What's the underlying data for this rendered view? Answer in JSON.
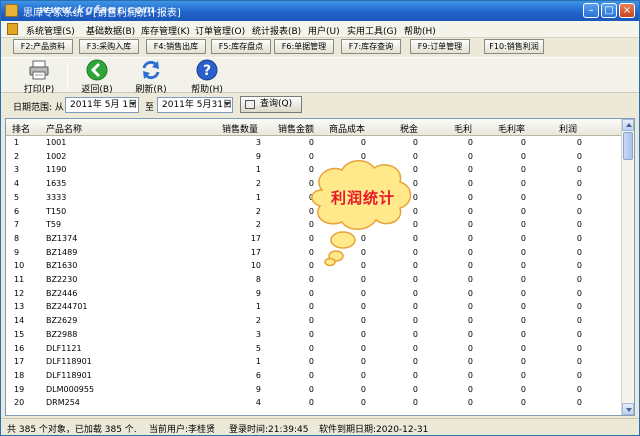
{
  "window": {
    "title": "思库专家系统 - [销售利润统计报表]",
    "watermark": "www.kgfanr.com"
  },
  "menu": {
    "items": [
      "系统管理(S)",
      "基础数据(B)",
      "库存管理(K)",
      "订单管理(O)",
      "统计报表(B)",
      "用户(U)",
      "实用工具(G)",
      "帮助(H)"
    ]
  },
  "fkeys": [
    "F2:产品资料",
    "F3:采购入库",
    "F4:销售出库",
    "F5:库存盘点",
    "F6:单据管理",
    "F7:库存查询",
    "F9:订单管理",
    "F10:销售利润"
  ],
  "toolbar": {
    "print": "打印(P)",
    "back": "返回(B)",
    "refresh": "刷新(R)",
    "help": "帮助(H)"
  },
  "filter": {
    "range_label": "日期范围: 从",
    "from_date": "2011年 5月 1日",
    "to_label": "至",
    "to_date": "2011年 5月31日",
    "query_label": "查询(Q)"
  },
  "table": {
    "columns": [
      "排名",
      "产品名称",
      "销售数量",
      "销售金额",
      "商品成本",
      "税金",
      "毛利",
      "毛利率",
      "利润"
    ],
    "rows": [
      [
        "1",
        "1001",
        "3",
        "0",
        "0",
        "0",
        "0",
        "0",
        "0"
      ],
      [
        "2",
        "1002",
        "9",
        "0",
        "0",
        "0",
        "0",
        "0",
        "0"
      ],
      [
        "3",
        "1190",
        "1",
        "0",
        "0",
        "0",
        "0",
        "0",
        "0"
      ],
      [
        "4",
        "1635",
        "2",
        "0",
        "0",
        "0",
        "0",
        "0",
        "0"
      ],
      [
        "5",
        "3333",
        "1",
        "0",
        "0",
        "0",
        "0",
        "0",
        "0"
      ],
      [
        "6",
        "T150",
        "2",
        "0",
        "0",
        "0",
        "0",
        "0",
        "0"
      ],
      [
        "7",
        "T59",
        "2",
        "0",
        "0",
        "0",
        "0",
        "0",
        "0"
      ],
      [
        "8",
        "BZ1374",
        "17",
        "0",
        "0",
        "0",
        "0",
        "0",
        "0"
      ],
      [
        "9",
        "BZ1489",
        "17",
        "0",
        "0",
        "0",
        "0",
        "0",
        "0"
      ],
      [
        "10",
        "BZ1630",
        "10",
        "0",
        "0",
        "0",
        "0",
        "0",
        "0"
      ],
      [
        "11",
        "BZ2230",
        "8",
        "0",
        "0",
        "0",
        "0",
        "0",
        "0"
      ],
      [
        "12",
        "BZ2446",
        "9",
        "0",
        "0",
        "0",
        "0",
        "0",
        "0"
      ],
      [
        "13",
        "BZ244701",
        "1",
        "0",
        "0",
        "0",
        "0",
        "0",
        "0"
      ],
      [
        "14",
        "BZ2629",
        "2",
        "0",
        "0",
        "0",
        "0",
        "0",
        "0"
      ],
      [
        "15",
        "BZ2988",
        "3",
        "0",
        "0",
        "0",
        "0",
        "0",
        "0"
      ],
      [
        "16",
        "DLF1121",
        "5",
        "0",
        "0",
        "0",
        "0",
        "0",
        "0"
      ],
      [
        "17",
        "DLF118901",
        "1",
        "0",
        "0",
        "0",
        "0",
        "0",
        "0"
      ],
      [
        "18",
        "DLF118901",
        "6",
        "0",
        "0",
        "0",
        "0",
        "0",
        "0"
      ],
      [
        "19",
        "DLM000955",
        "9",
        "0",
        "0",
        "0",
        "0",
        "0",
        "0"
      ],
      [
        "20",
        "DRM254",
        "4",
        "0",
        "0",
        "0",
        "0",
        "0",
        "0"
      ]
    ]
  },
  "status": {
    "count": "共 385 个对象，已加载 385 个.",
    "user": "当前用户:李桂贤",
    "login": "登录时间:21:39:45",
    "expire": "软件到期日期:2020-12-31"
  },
  "callout": {
    "text": "利润统计"
  },
  "colors": {
    "titlebar": "#1f62c9",
    "callout_fill": "#ffe98a",
    "callout_text": "#e8172a"
  }
}
